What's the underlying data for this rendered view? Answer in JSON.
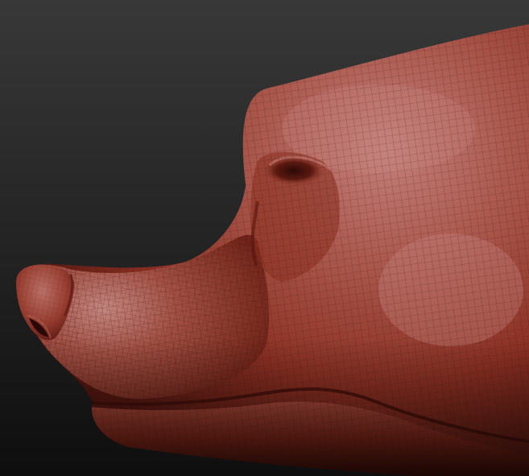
{
  "scene": {
    "subject": "sculpted-animal-head",
    "material": "red-wax-matcap",
    "wireframe": true
  },
  "colors": {
    "background_top": "#363636",
    "background_bottom": "#101010",
    "clay_highlight": "#c77f77",
    "clay_base": "#9a3a2c",
    "clay_shadow": "#4a140e",
    "wire": "#3b0f0a"
  }
}
